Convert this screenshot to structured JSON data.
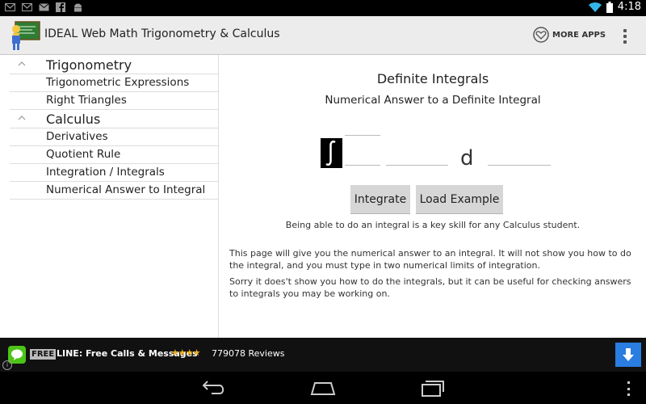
{
  "status_bar": {
    "time": "4:18",
    "left_icons": [
      "gmail-icon",
      "gmail-icon",
      "mail-icon",
      "facebook-icon",
      "android-icon"
    ],
    "right_icons": [
      "wifi-icon",
      "battery-icon"
    ]
  },
  "action_bar": {
    "title": "IDEAL Web Math Trigonometry & Calculus",
    "more_apps_label": "MORE APPS"
  },
  "sidebar": {
    "sections": [
      {
        "label": "Trigonometry",
        "items": [
          "Trigonometric Expressions",
          "Right Triangles"
        ]
      },
      {
        "label": "Calculus",
        "items": [
          "Derivatives",
          "Quotient Rule",
          "Integration / Integrals",
          "Numerical Answer to Integral"
        ]
      }
    ]
  },
  "main": {
    "title": "Definite Integrals",
    "subtitle": "Numerical Answer to a Definite Integral",
    "upper_limit": "",
    "lower_limit": "",
    "integrand": "",
    "d_label": "d",
    "variable": "",
    "integrate_button": "Integrate",
    "load_example_button": "Load Example",
    "intro": "Being able to do an integral is a key skill for any Calculus student.",
    "paragraph1": "This page will give you the numerical answer to an integral. It will not show you how to do the integral, and you must type in two numerical limits of integration.",
    "paragraph2": "Sorry it does't show you how to do the integrals, but it can be useful for checking answers to integrals you may be working on."
  },
  "ad": {
    "free_badge": "FREE",
    "title": "LINE: Free Calls & Messages",
    "stars": "★★★★",
    "reviews": "779078 Reviews"
  },
  "colors": {
    "action_bar_bg": "#ececec",
    "button_bg": "#d6d6d6",
    "ad_accent": "#2a7de1",
    "line_green": "#4cc418",
    "wifi_blue": "#33b5e5"
  }
}
